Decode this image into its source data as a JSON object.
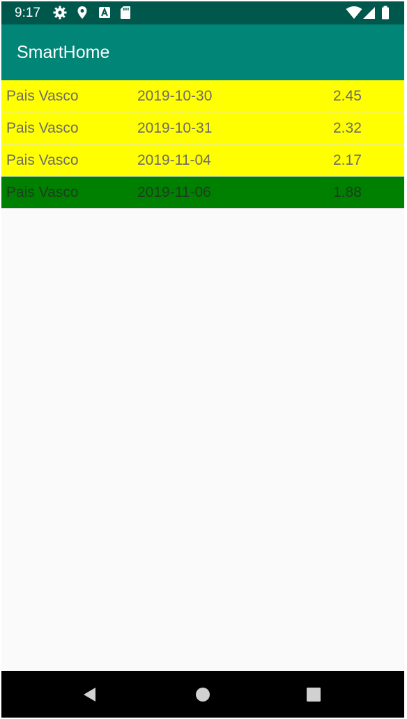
{
  "status_bar": {
    "time": "9:17",
    "background": "#00574b",
    "icons": [
      "settings-icon",
      "location-icon",
      "a-icon",
      "sd-card-icon",
      "wifi-icon",
      "signal-icon",
      "battery-icon"
    ]
  },
  "app_bar": {
    "title": "SmartHome",
    "background": "#008577"
  },
  "colors": {
    "highlight_yellow": "#ffff00",
    "highlight_green": "#008000",
    "row_text": "#6b6b6b"
  },
  "rows": [
    {
      "region": "Pais Vasco",
      "date": "2019-10-30",
      "price": "2.45",
      "color": "#ffff00"
    },
    {
      "region": "Pais Vasco",
      "date": "2019-10-31",
      "price": "2.32",
      "color": "#ffff00"
    },
    {
      "region": "Pais Vasco",
      "date": "2019-11-04",
      "price": "2.17",
      "color": "#ffff00"
    },
    {
      "region": "Pais Vasco",
      "date": "2019-11-06",
      "price": "1.88",
      "color": "#008000"
    }
  ],
  "nav_bar": {
    "buttons": [
      "back-icon",
      "home-icon",
      "recents-icon"
    ]
  }
}
